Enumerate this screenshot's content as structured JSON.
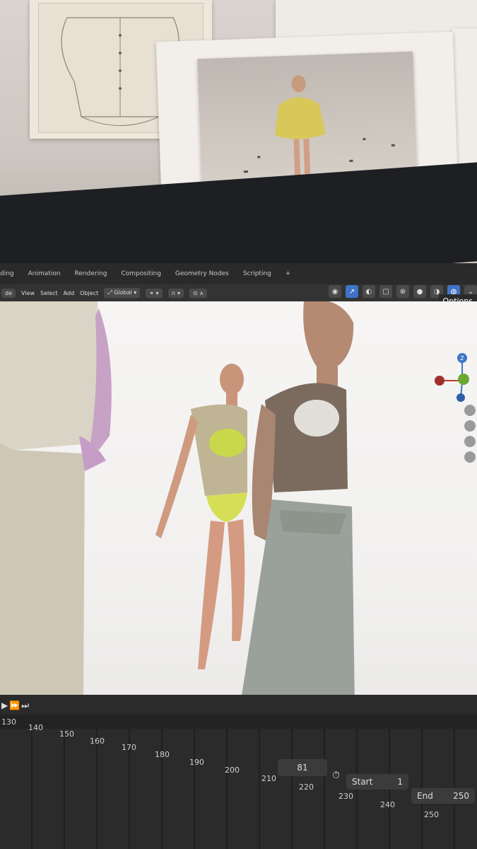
{
  "workspace_tabs": [
    "ding",
    "Animation",
    "Rendering",
    "Compositing",
    "Geometry Nodes",
    "Scripting",
    "+"
  ],
  "header_menu": [
    "de",
    "View",
    "Select",
    "Add",
    "Object"
  ],
  "transform_orientation": "Global",
  "options_label": "Options",
  "gizmo_axis_label": "Z",
  "timeline": {
    "ticks": [
      "130",
      "140",
      "150",
      "160",
      "170",
      "180",
      "190",
      "200",
      "210",
      "220",
      "230",
      "240",
      "250"
    ],
    "current_frame": "81",
    "start_label": "Start",
    "start_value": "1",
    "end_label": "End",
    "end_value": "250"
  },
  "colors": {
    "accent_blue": "#3f74c8",
    "panel_dark": "#2b2b2b",
    "axis_x": "#c0392b",
    "axis_y": "#6aa832",
    "axis_z": "#3f74c8"
  }
}
